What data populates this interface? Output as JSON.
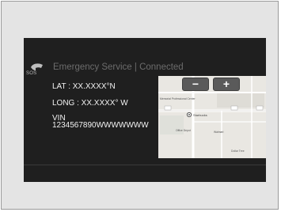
{
  "header": {
    "title": "Emergency Service | Connected",
    "sos_label": "SOS",
    "icon": "phone-icon"
  },
  "location": {
    "lat_line": "LAT    : XX.XXXX°N",
    "long_line": "LONG : XX.XXXX° W"
  },
  "vehicle": {
    "vin_label": "VIN",
    "vin_value": "1234567890WWWWWWW"
  },
  "map": {
    "zoom_out_label": "−",
    "zoom_in_label": "+",
    "poi_starbucks": "Starbucks",
    "poi_walmart": "Walmart",
    "poi_office_depot": "Office Depot",
    "poi_dollar_tree": "Dollar Tree",
    "poi_memorial": "Memorial Professional Center"
  },
  "colors": {
    "screen_bg": "#1f1f1f",
    "title_text": "#6c6c6c",
    "info_text": "#f2f2f2",
    "map_bg": "#e9e7e2"
  }
}
